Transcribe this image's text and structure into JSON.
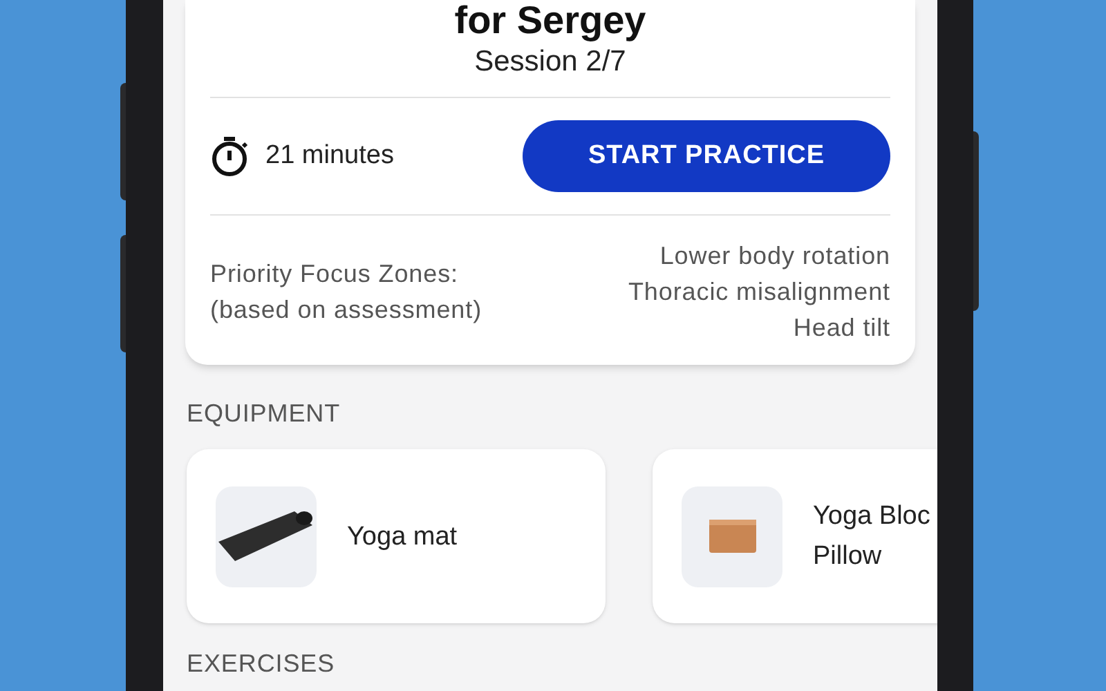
{
  "session": {
    "title": "for Sergey",
    "subtitle": "Session 2/7",
    "duration": "21 minutes",
    "start_button": "START PRACTICE",
    "focus_label": "Priority Focus Zones:",
    "focus_note": "(based on assessment)",
    "focus_zones": [
      "Lower body rotation",
      "Thoracic misalignment",
      "Head tilt"
    ]
  },
  "equipment": {
    "heading": "EQUIPMENT",
    "items": [
      {
        "name": "Yoga mat",
        "kind": "mat"
      },
      {
        "name": "Yoga Bloc Pillow",
        "kind": "block"
      }
    ]
  },
  "exercises": {
    "heading": "EXERCISES"
  }
}
